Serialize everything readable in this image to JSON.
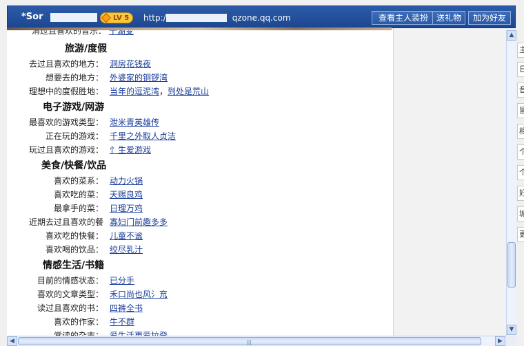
{
  "header": {
    "name_prefix": "*Sor",
    "level": "LV 5",
    "url_prefix": "http://",
    "url_suffix": "qzone.qq.com",
    "buttons": [
      "查看主人装扮",
      "送礼物",
      "加为好友"
    ]
  },
  "truncated_top": {
    "label": "消过且喜欢的音乐：",
    "value": "千湖变"
  },
  "sections": [
    {
      "title": "旅游/度假",
      "rows": [
        {
          "label": "去过且喜欢的地方：",
          "value": "洞房花钱夜"
        },
        {
          "label": "想要去的地方：",
          "value": "外婆家的铜锣湾"
        },
        {
          "label": "理想中的度假胜地：",
          "value": "当年的逗泥湾",
          "sep": "，",
          "value2": "到处是荒山"
        }
      ]
    },
    {
      "title": "电子游戏/网游",
      "rows": [
        {
          "label": "最喜欢的游戏类型：",
          "value": "泄米青英雄传"
        },
        {
          "label": "正在玩的游戏：",
          "value": "千里之外取人贞洁"
        },
        {
          "label": "玩过且喜欢的游戏：",
          "value": "忄生爱游戏"
        }
      ]
    },
    {
      "title": "美食/快餐/饮品",
      "rows": [
        {
          "label": "喜欢的菜系：",
          "value": "动力火锅"
        },
        {
          "label": "喜欢吃的菜：",
          "value": "天赐良鸡"
        },
        {
          "label": "最拿手的菜：",
          "value": "日理万鸡"
        },
        {
          "label": "近期去过且喜欢的餐",
          "value": "寡妇门前趣多多"
        },
        {
          "label": "喜欢吃的快餐：",
          "value": "儿童不谧"
        },
        {
          "label": "喜欢喝的饮品：",
          "value": "绞尽乳汁"
        }
      ]
    },
    {
      "title": "情感生活/书籍",
      "rows": [
        {
          "label": "目前的情感状态：",
          "value": "已分手"
        },
        {
          "label": "喜欢的文章类型：",
          "value": "禾口尚也风氵㐬"
        },
        {
          "label": "读过且喜欢的书：",
          "value": "四裤全书"
        },
        {
          "label": "喜欢的作家：",
          "value": "牛不群"
        },
        {
          "label": "常读的杂志：",
          "value": "爱生活更爱拉登"
        }
      ]
    }
  ],
  "right_tabs": [
    "主",
    "日",
    "音",
    "留",
    "相",
    "个",
    "个",
    "好",
    "城",
    "更"
  ],
  "scroll_icons": {
    "up": "triangle-up",
    "down": "triangle-down",
    "left": "triangle-left",
    "right": "triangle-right"
  }
}
